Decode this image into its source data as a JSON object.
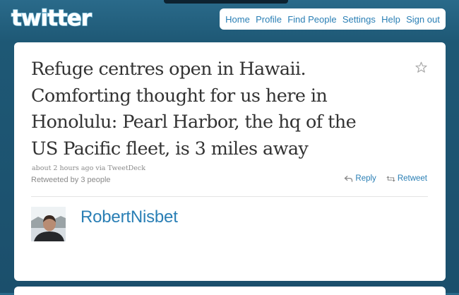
{
  "header": {
    "logo_text": "twitter",
    "nav": [
      "Home",
      "Profile",
      "Find People",
      "Settings",
      "Help",
      "Sign out"
    ]
  },
  "tweet": {
    "lines": [
      "Refuge centres open in Hawaii.",
      "Comforting thought for us here in",
      "Honolulu: Pearl Harbor, the hq of the",
      "US Pacific fleet, is 3 miles away"
    ],
    "timestamp": "about 2 hours ago",
    "via_label": "via",
    "client": "TweetDeck",
    "retweeted_by": "Retweeted by 3 people",
    "actions": {
      "reply_label": "Reply",
      "retweet_label": "Retweet"
    },
    "favorite_icon": "star-icon"
  },
  "author": {
    "username": "RobertNisbet",
    "avatar_icon": "avatar-photo"
  },
  "colors": {
    "background": "#1f5a78",
    "link": "#2a7fb5",
    "text": "#333333",
    "muted": "#8a8a8a"
  }
}
